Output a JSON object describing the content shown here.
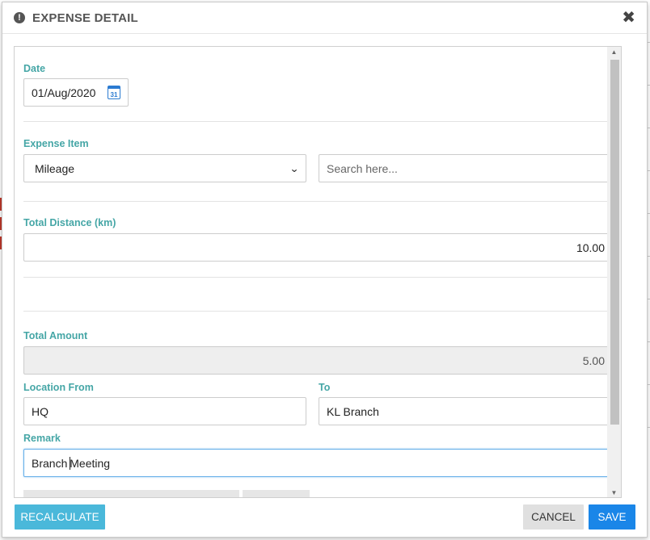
{
  "dialog": {
    "title": "EXPENSE DETAIL",
    "info_icon": "!",
    "close_icon": "✖"
  },
  "form": {
    "date": {
      "label": "Date",
      "value": "01/Aug/2020",
      "calendar_day": "31"
    },
    "expense_item": {
      "label": "Expense Item",
      "selected": "Mileage",
      "search_placeholder": "Search here..."
    },
    "total_distance": {
      "label": "Total Distance (km)",
      "value": "10.00"
    },
    "total_amount": {
      "label": "Total Amount",
      "value": "5.00"
    },
    "location_from": {
      "label": "Location From",
      "value": "HQ"
    },
    "location_to": {
      "label": "To",
      "value": "KL Branch"
    },
    "remark": {
      "label": "Remark",
      "value_before_caret": "Branch ",
      "value_after_caret": "Meeting"
    }
  },
  "footer": {
    "recalculate": "RECALCULATE",
    "cancel": "CANCEL",
    "save": "SAVE"
  },
  "colors": {
    "label": "#45a6a6",
    "recalculate_bg": "#4ab8da",
    "save_bg": "#1a86e8",
    "cancel_bg": "#e0e0e0"
  }
}
